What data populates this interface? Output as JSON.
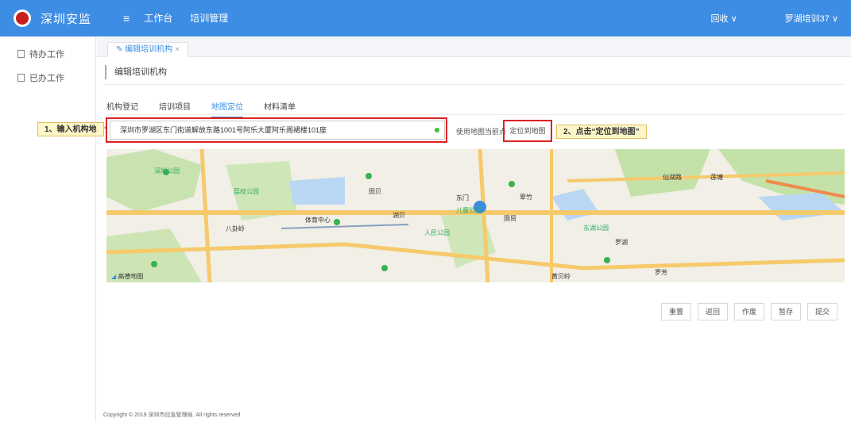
{
  "topbar": {
    "brand": "深圳安监",
    "nav": [
      {
        "label": "工作台"
      },
      {
        "label": "培训管理"
      }
    ],
    "right_dropdown": "回收",
    "user": "罗湖培训37"
  },
  "sidebar": {
    "items": [
      {
        "label": "待办工作"
      },
      {
        "label": "已办工作"
      }
    ]
  },
  "tabbar": {
    "active_tab": "编辑培训机构"
  },
  "page": {
    "title": "编辑培训机构",
    "subtabs": [
      {
        "label": "机构登记"
      },
      {
        "label": "培训项目"
      },
      {
        "label": "地图定位"
      },
      {
        "label": "材料清单"
      }
    ],
    "address_value": "深圳市罗湖区东门街道解放东路1001号阿乐大厦阿乐阁裙楼101座",
    "use_map_point_label": "使用地图当前点",
    "locate_button_label": "定位到地图",
    "annotation_1": "1、输入机构地",
    "annotation_2": "2、点击“定位到地图”",
    "map_credit": "高德地图",
    "map_labels": [
      "深圳公园",
      "人民公园",
      "儿童公园",
      "荔枝公园",
      "东湖公园",
      "仙湖路",
      "莲塘",
      "罗湖",
      "体育中心",
      "八卦岭",
      "翠竹",
      "黄贝岭",
      "罗芳",
      "田贝",
      "湖贝",
      "东门",
      "国贸"
    ],
    "actions": [
      {
        "label": "重置"
      },
      {
        "label": "返回"
      },
      {
        "label": "作废"
      },
      {
        "label": "暂存"
      },
      {
        "label": "提交"
      }
    ]
  },
  "footer": {
    "text": "Copyright © 2019 深圳市应急管理局. All rights reserved"
  },
  "colors": {
    "topbar": "#3d8de4",
    "accent": "#3d8de4",
    "annotation_border": "#d22222",
    "annotation_bg": "#fdf6c8"
  }
}
